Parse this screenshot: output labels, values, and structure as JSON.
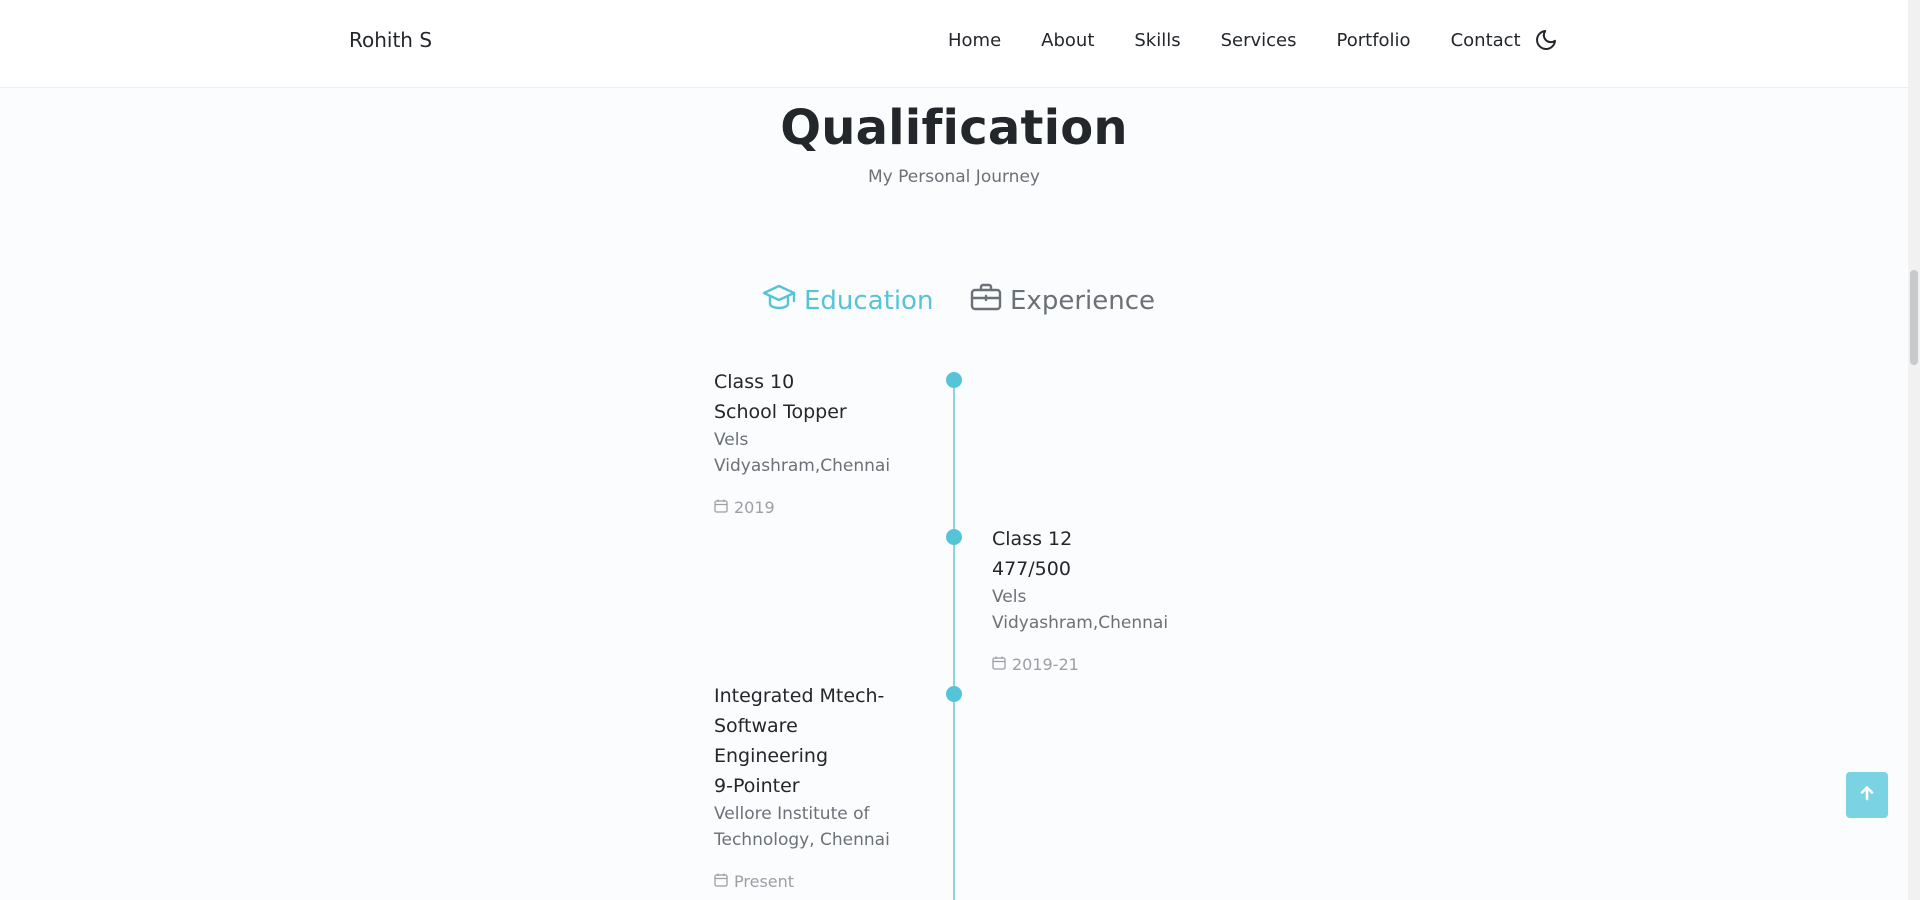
{
  "header": {
    "brand": "Rohith S",
    "nav": [
      "Home",
      "About",
      "Skills",
      "Services",
      "Portfolio",
      "Contact"
    ],
    "theme_toggle_icon": "moon-icon"
  },
  "section": {
    "title": "Qualification",
    "subtitle": "My Personal Journey"
  },
  "tabs": [
    {
      "label": "Education",
      "icon": "graduation-cap-icon",
      "active": true
    },
    {
      "label": "Experience",
      "icon": "briefcase-icon",
      "active": false
    }
  ],
  "timeline": [
    {
      "title_lines": [
        "Class 10",
        "School Topper"
      ],
      "sub_lines": [
        "Vels",
        "Vidyashram,Chennai"
      ],
      "date": "2019",
      "side": "left"
    },
    {
      "title_lines": [
        "Class 12",
        "477/500"
      ],
      "sub_lines": [
        "Vels",
        "Vidyashram,Chennai"
      ],
      "date": "2019-21",
      "side": "right"
    },
    {
      "title_lines": [
        "Integrated Mtech-",
        "Software",
        "Engineering",
        "9-Pointer"
      ],
      "sub_lines": [
        "Vellore Institute of",
        "Technology, Chennai"
      ],
      "date": "Present",
      "side": "left"
    }
  ],
  "colors": {
    "accent": "#56c4d8",
    "text": "#23262b",
    "muted": "#6b7177"
  },
  "scroll_top_icon": "arrow-up-icon"
}
